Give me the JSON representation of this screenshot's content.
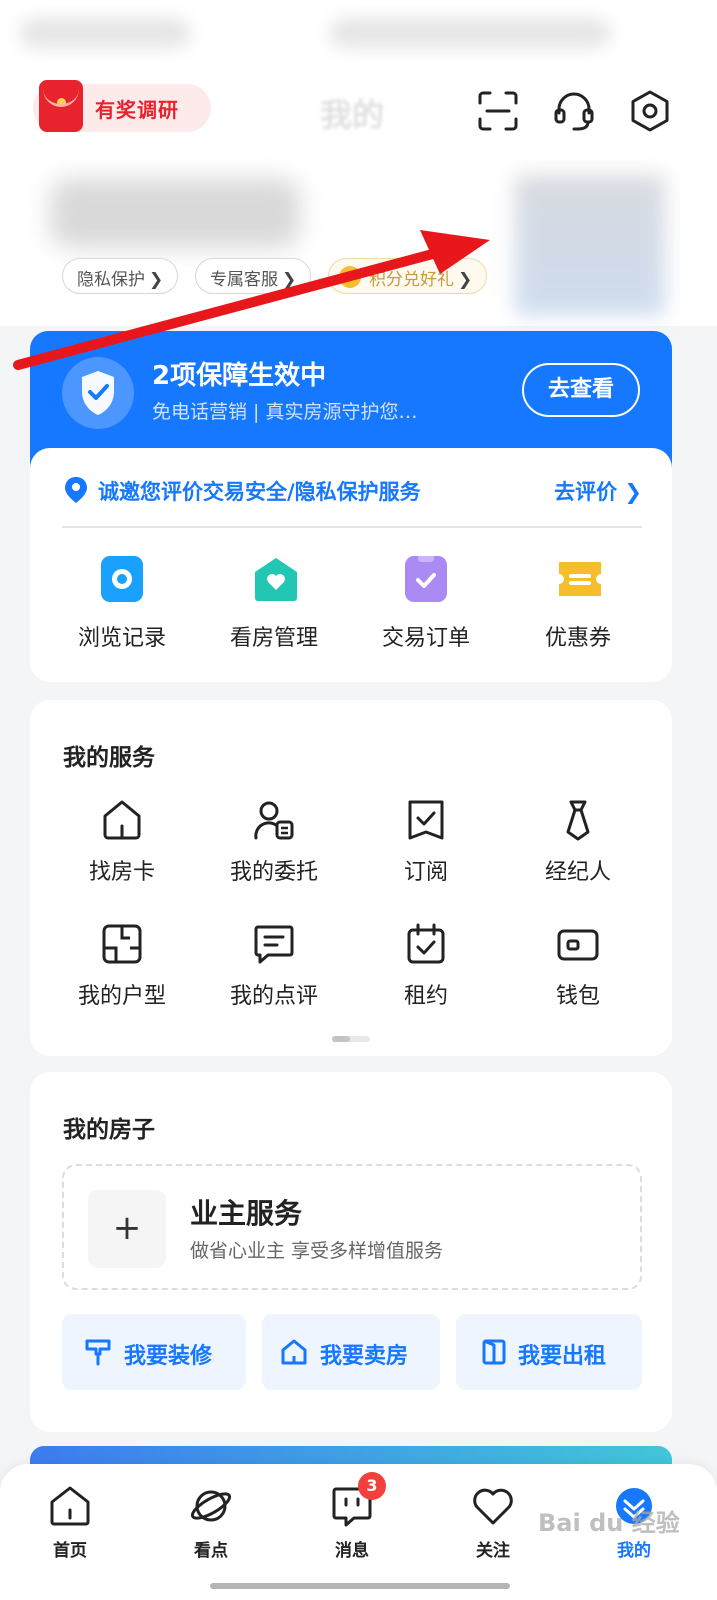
{
  "header": {
    "survey_badge": "有奖调研",
    "page_title": "我的",
    "icons": [
      "scan-icon",
      "customer-service-icon",
      "settings-icon"
    ]
  },
  "profile": {
    "pills": [
      {
        "label": "隐私保护"
      },
      {
        "label": "专属客服"
      },
      {
        "label": "积分兑好礼"
      }
    ],
    "chevron": "❯"
  },
  "protection_banner": {
    "title": "2项保障生效中",
    "subtitle": "免电话营销 | 真实房源守护您…",
    "button": "去查看",
    "color": "#1677ff"
  },
  "evaluation": {
    "text": "诚邀您评价交易安全/隐私保护服务",
    "link": "去评价",
    "chevron": "❯"
  },
  "quick_actions": [
    {
      "label": "浏览记录",
      "color": "#1aa0ff"
    },
    {
      "label": "看房管理",
      "color": "#22c7b3"
    },
    {
      "label": "交易订单",
      "color": "#a98bf3"
    },
    {
      "label": "优惠券",
      "color": "#f6bd2c"
    }
  ],
  "services": {
    "title": "我的服务",
    "items": [
      {
        "label": "找房卡",
        "icon": "house-outline-icon"
      },
      {
        "label": "我的委托",
        "icon": "person-card-icon"
      },
      {
        "label": "订阅",
        "icon": "bookmark-check-icon"
      },
      {
        "label": "经纪人",
        "icon": "agent-tie-icon"
      },
      {
        "label": "我的户型",
        "icon": "floorplan-icon"
      },
      {
        "label": "我的点评",
        "icon": "comment-icon"
      },
      {
        "label": "租约",
        "icon": "calendar-check-icon"
      },
      {
        "label": "钱包",
        "icon": "wallet-icon"
      }
    ]
  },
  "my_house": {
    "title": "我的房子",
    "owner_title": "业主服务",
    "owner_sub": "做省心业主 享受多样增值服务",
    "plus": "+",
    "actions": [
      {
        "label": "我要装修",
        "icon": "paint-roller-icon"
      },
      {
        "label": "我要卖房",
        "icon": "house-icon"
      },
      {
        "label": "我要出租",
        "icon": "door-icon"
      }
    ]
  },
  "bottom_nav": {
    "items": [
      {
        "label": "首页"
      },
      {
        "label": "看点"
      },
      {
        "label": "消息",
        "badge": "3"
      },
      {
        "label": "关注"
      },
      {
        "label": "我的"
      }
    ],
    "accent": "#1677ff"
  },
  "watermark": "Bai du 经验"
}
